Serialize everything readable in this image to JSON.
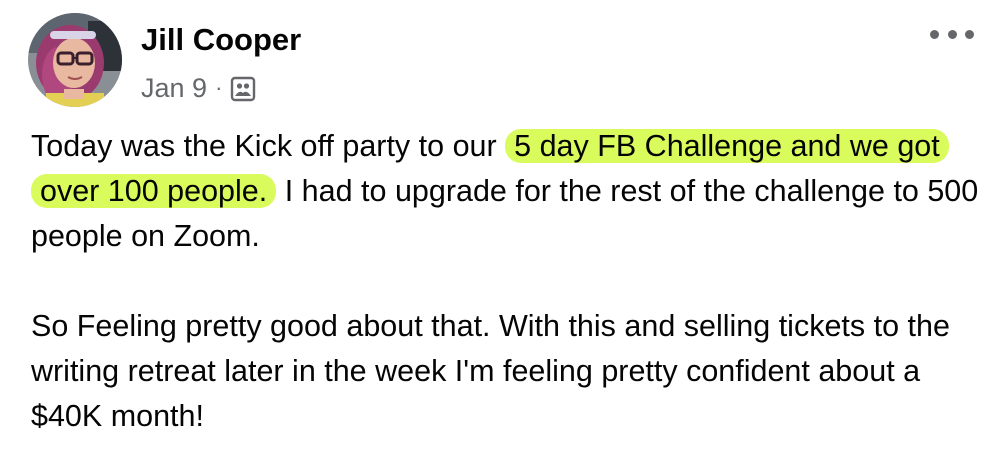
{
  "post": {
    "author": {
      "name": "Jill Cooper",
      "avatar_icon": "profile-photo"
    },
    "meta": {
      "date": "Jan 9",
      "separator": "·",
      "audience_icon": "group-members-icon"
    },
    "more_icon": "more-options-icon",
    "body": {
      "p1_before": "Today was the Kick off party to our",
      "p1_highlight": "5 day FB Challenge and we got over 100 people.",
      "p1_after": "I had to upgrade for the rest of the challenge to 500 people on Zoom.",
      "p2": "So Feeling pretty good about that. With this and selling tickets to the writing retreat later in the week I'm feeling pretty confident about a $40K month!"
    },
    "colors": {
      "highlight": "#d9fb5b",
      "text": "#050505",
      "secondary_text": "#65676b"
    }
  }
}
